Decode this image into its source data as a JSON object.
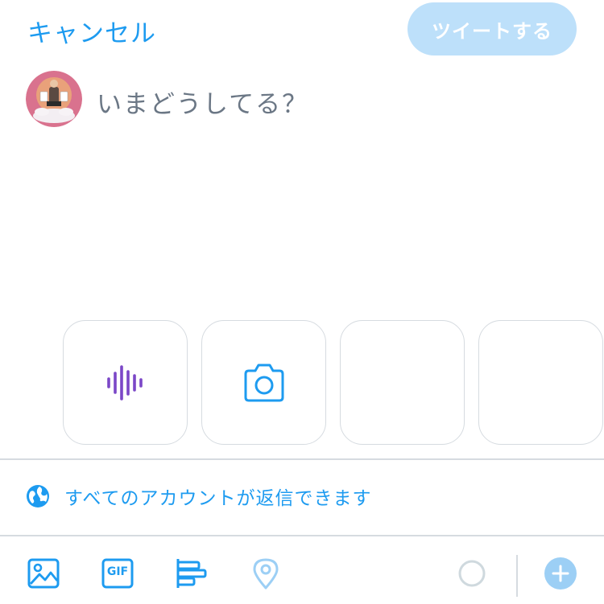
{
  "header": {
    "cancel_label": "キャンセル",
    "tweet_label": "ツイートする"
  },
  "compose": {
    "placeholder": "いまどうしてる？"
  },
  "media_tiles": [
    {
      "icon": "voice-waveform-icon"
    },
    {
      "icon": "camera-icon"
    },
    {
      "icon": "photo-thumbnail"
    },
    {
      "icon": "photo-thumbnail"
    }
  ],
  "reply_setting": {
    "label": "すべてのアカウントが返信できます",
    "icon": "globe-icon"
  },
  "toolbar": {
    "items": [
      "image-icon",
      "gif-icon",
      "poll-icon",
      "location-icon",
      "char-count-ring",
      "add-thread-icon"
    ],
    "gif_label": "GIF"
  },
  "colors": {
    "accent": "#1d9bf0",
    "accent_disabled": "#bde0fa",
    "voice": "#7b47c7",
    "border": "#d6dbe0"
  }
}
